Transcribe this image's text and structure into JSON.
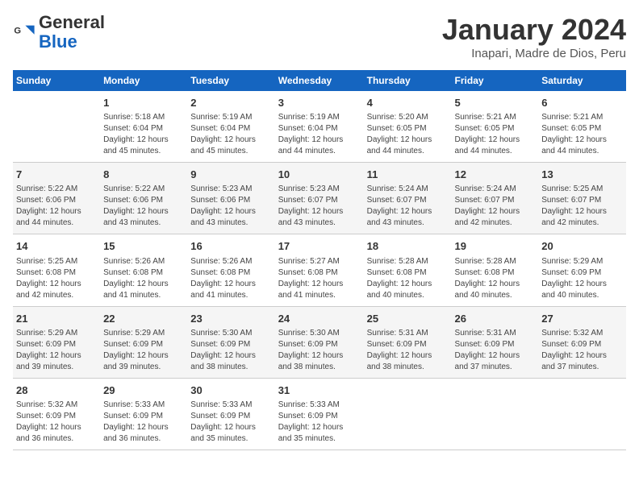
{
  "header": {
    "logo_general": "General",
    "logo_blue": "Blue",
    "month_title": "January 2024",
    "subtitle": "Inapari, Madre de Dios, Peru"
  },
  "columns": [
    "Sunday",
    "Monday",
    "Tuesday",
    "Wednesday",
    "Thursday",
    "Friday",
    "Saturday"
  ],
  "weeks": [
    [
      {
        "day": "",
        "info": ""
      },
      {
        "day": "1",
        "info": "Sunrise: 5:18 AM\nSunset: 6:04 PM\nDaylight: 12 hours\nand 45 minutes."
      },
      {
        "day": "2",
        "info": "Sunrise: 5:19 AM\nSunset: 6:04 PM\nDaylight: 12 hours\nand 45 minutes."
      },
      {
        "day": "3",
        "info": "Sunrise: 5:19 AM\nSunset: 6:04 PM\nDaylight: 12 hours\nand 44 minutes."
      },
      {
        "day": "4",
        "info": "Sunrise: 5:20 AM\nSunset: 6:05 PM\nDaylight: 12 hours\nand 44 minutes."
      },
      {
        "day": "5",
        "info": "Sunrise: 5:21 AM\nSunset: 6:05 PM\nDaylight: 12 hours\nand 44 minutes."
      },
      {
        "day": "6",
        "info": "Sunrise: 5:21 AM\nSunset: 6:05 PM\nDaylight: 12 hours\nand 44 minutes."
      }
    ],
    [
      {
        "day": "7",
        "info": "Sunrise: 5:22 AM\nSunset: 6:06 PM\nDaylight: 12 hours\nand 44 minutes."
      },
      {
        "day": "8",
        "info": "Sunrise: 5:22 AM\nSunset: 6:06 PM\nDaylight: 12 hours\nand 43 minutes."
      },
      {
        "day": "9",
        "info": "Sunrise: 5:23 AM\nSunset: 6:06 PM\nDaylight: 12 hours\nand 43 minutes."
      },
      {
        "day": "10",
        "info": "Sunrise: 5:23 AM\nSunset: 6:07 PM\nDaylight: 12 hours\nand 43 minutes."
      },
      {
        "day": "11",
        "info": "Sunrise: 5:24 AM\nSunset: 6:07 PM\nDaylight: 12 hours\nand 43 minutes."
      },
      {
        "day": "12",
        "info": "Sunrise: 5:24 AM\nSunset: 6:07 PM\nDaylight: 12 hours\nand 42 minutes."
      },
      {
        "day": "13",
        "info": "Sunrise: 5:25 AM\nSunset: 6:07 PM\nDaylight: 12 hours\nand 42 minutes."
      }
    ],
    [
      {
        "day": "14",
        "info": "Sunrise: 5:25 AM\nSunset: 6:08 PM\nDaylight: 12 hours\nand 42 minutes."
      },
      {
        "day": "15",
        "info": "Sunrise: 5:26 AM\nSunset: 6:08 PM\nDaylight: 12 hours\nand 41 minutes."
      },
      {
        "day": "16",
        "info": "Sunrise: 5:26 AM\nSunset: 6:08 PM\nDaylight: 12 hours\nand 41 minutes."
      },
      {
        "day": "17",
        "info": "Sunrise: 5:27 AM\nSunset: 6:08 PM\nDaylight: 12 hours\nand 41 minutes."
      },
      {
        "day": "18",
        "info": "Sunrise: 5:28 AM\nSunset: 6:08 PM\nDaylight: 12 hours\nand 40 minutes."
      },
      {
        "day": "19",
        "info": "Sunrise: 5:28 AM\nSunset: 6:08 PM\nDaylight: 12 hours\nand 40 minutes."
      },
      {
        "day": "20",
        "info": "Sunrise: 5:29 AM\nSunset: 6:09 PM\nDaylight: 12 hours\nand 40 minutes."
      }
    ],
    [
      {
        "day": "21",
        "info": "Sunrise: 5:29 AM\nSunset: 6:09 PM\nDaylight: 12 hours\nand 39 minutes."
      },
      {
        "day": "22",
        "info": "Sunrise: 5:29 AM\nSunset: 6:09 PM\nDaylight: 12 hours\nand 39 minutes."
      },
      {
        "day": "23",
        "info": "Sunrise: 5:30 AM\nSunset: 6:09 PM\nDaylight: 12 hours\nand 38 minutes."
      },
      {
        "day": "24",
        "info": "Sunrise: 5:30 AM\nSunset: 6:09 PM\nDaylight: 12 hours\nand 38 minutes."
      },
      {
        "day": "25",
        "info": "Sunrise: 5:31 AM\nSunset: 6:09 PM\nDaylight: 12 hours\nand 38 minutes."
      },
      {
        "day": "26",
        "info": "Sunrise: 5:31 AM\nSunset: 6:09 PM\nDaylight: 12 hours\nand 37 minutes."
      },
      {
        "day": "27",
        "info": "Sunrise: 5:32 AM\nSunset: 6:09 PM\nDaylight: 12 hours\nand 37 minutes."
      }
    ],
    [
      {
        "day": "28",
        "info": "Sunrise: 5:32 AM\nSunset: 6:09 PM\nDaylight: 12 hours\nand 36 minutes."
      },
      {
        "day": "29",
        "info": "Sunrise: 5:33 AM\nSunset: 6:09 PM\nDaylight: 12 hours\nand 36 minutes."
      },
      {
        "day": "30",
        "info": "Sunrise: 5:33 AM\nSunset: 6:09 PM\nDaylight: 12 hours\nand 35 minutes."
      },
      {
        "day": "31",
        "info": "Sunrise: 5:33 AM\nSunset: 6:09 PM\nDaylight: 12 hours\nand 35 minutes."
      },
      {
        "day": "",
        "info": ""
      },
      {
        "day": "",
        "info": ""
      },
      {
        "day": "",
        "info": ""
      }
    ]
  ]
}
